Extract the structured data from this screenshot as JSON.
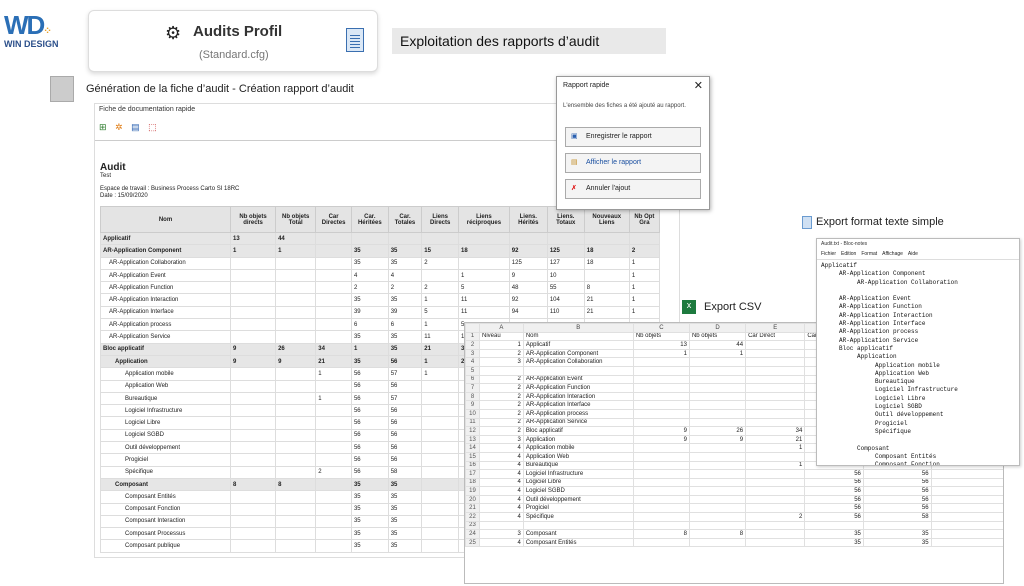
{
  "logo": {
    "brand": "WIN DESIGN"
  },
  "profil": {
    "title": "Audits Profil",
    "subtitle": "(Standard.cfg)"
  },
  "banner": "Exploitation des rapports d’audit",
  "generation": "Génération de la fiche d’audit - Création rapport d’audit",
  "main": {
    "window_title": "Fiche de documentation rapide",
    "audit": "Audit",
    "test": "Test",
    "espace": "Espace de travail : Business Process Carto SI 18RC",
    "date": "Date : 15/09/2020",
    "headers": [
      "Nom",
      "Nb objets directs",
      "Nb objets Total",
      "Car Directes",
      "Car. Héritées",
      "Car. Totales",
      "Liens Directs",
      "Liens réciproques",
      "Liens. Hérités",
      "Liens. Totaux",
      "Nouveaux Liens",
      "Nb Opt Gra"
    ],
    "rows": [
      [
        "Applicatif",
        "13",
        "44",
        "",
        "",
        "",
        "",
        "",
        "",
        "",
        "",
        ""
      ],
      [
        "AR-Application Component",
        "1",
        "1",
        "",
        "35",
        "35",
        "15",
        "18",
        "92",
        "125",
        "18",
        "2"
      ],
      [
        "AR-Application Collaboration",
        "",
        "",
        "",
        "35",
        "35",
        "2",
        "",
        "125",
        "127",
        "18",
        "1"
      ],
      [
        "AR-Application Event",
        "",
        "",
        "",
        "4",
        "4",
        "",
        "1",
        "9",
        "10",
        "",
        "1"
      ],
      [
        "AR-Application Function",
        "",
        "",
        "",
        "2",
        "2",
        "2",
        "5",
        "48",
        "55",
        "8",
        "1"
      ],
      [
        "AR-Application Interaction",
        "",
        "",
        "",
        "35",
        "35",
        "1",
        "11",
        "92",
        "104",
        "21",
        "1"
      ],
      [
        "AR-Application Interface",
        "",
        "",
        "",
        "39",
        "39",
        "5",
        "11",
        "94",
        "110",
        "21",
        "1"
      ],
      [
        "AR-Application process",
        "",
        "",
        "",
        "6",
        "6",
        "1",
        "5",
        "",
        "",
        "",
        ""
      ],
      [
        "AR-Application Service",
        "",
        "",
        "",
        "35",
        "35",
        "11",
        "1",
        "",
        "",
        "",
        ""
      ],
      [
        "Bloc applicatif",
        "9",
        "26",
        "34",
        "1",
        "35",
        "21",
        "3",
        "",
        "",
        "",
        ""
      ],
      [
        "Application",
        "9",
        "9",
        "21",
        "35",
        "56",
        "1",
        "2",
        "",
        "",
        "",
        ""
      ],
      [
        "Application mobile",
        "",
        "",
        "1",
        "56",
        "57",
        "1",
        "",
        "",
        "",
        "",
        ""
      ],
      [
        "Application Web",
        "",
        "",
        "",
        "56",
        "56",
        "",
        "",
        "",
        "",
        "",
        ""
      ],
      [
        "Bureautique",
        "",
        "",
        "1",
        "56",
        "57",
        "",
        "",
        "",
        "",
        "",
        ""
      ],
      [
        "Logiciel Infrastructure",
        "",
        "",
        "",
        "56",
        "56",
        "",
        "",
        "",
        "",
        "",
        ""
      ],
      [
        "Logiciel Libre",
        "",
        "",
        "",
        "56",
        "56",
        "",
        "",
        "",
        "",
        "",
        ""
      ],
      [
        "Logiciel SGBD",
        "",
        "",
        "",
        "56",
        "56",
        "",
        "",
        "",
        "",
        "",
        ""
      ],
      [
        "Outil développement",
        "",
        "",
        "",
        "56",
        "56",
        "",
        "",
        "",
        "",
        "",
        ""
      ],
      [
        "Progiciel",
        "",
        "",
        "",
        "56",
        "56",
        "",
        "",
        "",
        "",
        "",
        ""
      ],
      [
        "Spécifique",
        "",
        "",
        "2",
        "56",
        "58",
        "",
        "",
        "",
        "",
        "",
        ""
      ],
      [
        "Composant",
        "8",
        "8",
        "",
        "35",
        "35",
        "",
        "",
        "",
        "",
        "",
        ""
      ],
      [
        "Composant Entités",
        "",
        "",
        "",
        "35",
        "35",
        "",
        "",
        "",
        "",
        "",
        ""
      ],
      [
        "Composant Fonction",
        "",
        "",
        "",
        "35",
        "35",
        "",
        "",
        "",
        "",
        "",
        ""
      ],
      [
        "Composant Interaction",
        "",
        "",
        "",
        "35",
        "35",
        "",
        "",
        "",
        "",
        "",
        ""
      ],
      [
        "Composant Processus",
        "",
        "",
        "",
        "35",
        "35",
        "",
        "",
        "",
        "",
        "",
        ""
      ],
      [
        "Composant publique",
        "",
        "",
        "",
        "35",
        "35",
        "",
        "",
        "",
        "",
        "",
        ""
      ]
    ]
  },
  "dialog": {
    "title": "Rapport rapide",
    "message": "L'ensemble des fiches a été ajouté au rapport.",
    "b1": "Enregistrer le rapport",
    "b2": "Afficher le rapport",
    "b3": "Annuler l'ajout"
  },
  "csv": {
    "label": "Export CSV",
    "cols": [
      "A",
      "B",
      "C",
      "D",
      "E",
      "F",
      "G",
      "H"
    ],
    "rows": [
      [
        "1",
        "Niveau",
        "Nom",
        "Nb objets",
        "Nb objets",
        "Car Direct",
        "Car. Hériti",
        "Car. Totales",
        "Liens Directs"
      ],
      [
        "2",
        "1",
        "Applicatif",
        "13",
        "44",
        "",
        "",
        "",
        ""
      ],
      [
        "3",
        "2",
        "AR-Application Component",
        "1",
        "1",
        "",
        "35",
        "35",
        "15"
      ],
      [
        "4",
        "3",
        "AR-Application Collaboration",
        "",
        "",
        "",
        "35",
        "35",
        "2"
      ],
      [
        "5",
        "",
        "",
        "",
        "",
        "",
        "",
        "",
        ""
      ],
      [
        "6",
        "2",
        "AR-Application Event",
        "",
        "",
        "",
        "4",
        "4",
        ""
      ],
      [
        "7",
        "2",
        "AR-Application Function",
        "",
        "",
        "",
        "2",
        "2",
        "2"
      ],
      [
        "8",
        "2",
        "AR-Application Interaction",
        "",
        "",
        "",
        "35",
        "35",
        "1"
      ],
      [
        "9",
        "2",
        "AR-Application Interface",
        "",
        "",
        "",
        "39",
        "39",
        "5"
      ],
      [
        "10",
        "2",
        "AR-Application process",
        "",
        "",
        "",
        "6",
        "6",
        "1"
      ],
      [
        "11",
        "2",
        "AR-Application Service",
        "",
        "",
        "",
        "35",
        "35",
        "11"
      ],
      [
        "12",
        "2",
        "Bloc applicatif",
        "9",
        "26",
        "34",
        "1",
        "35",
        "21"
      ],
      [
        "13",
        "3",
        "Application",
        "9",
        "9",
        "21",
        "35",
        "56",
        "1"
      ],
      [
        "14",
        "4",
        "Application mobile",
        "",
        "",
        "1",
        "56",
        "57",
        "1"
      ],
      [
        "15",
        "4",
        "Application Web",
        "",
        "",
        "",
        "56",
        "56",
        ""
      ],
      [
        "16",
        "4",
        "Bureautique",
        "",
        "",
        "1",
        "56",
        "57",
        ""
      ],
      [
        "17",
        "4",
        "Logiciel Infrastructure",
        "",
        "",
        "",
        "56",
        "56",
        ""
      ],
      [
        "18",
        "4",
        "Logiciel Libre",
        "",
        "",
        "",
        "56",
        "56",
        ""
      ],
      [
        "19",
        "4",
        "Logiciel SGBD",
        "",
        "",
        "",
        "56",
        "56",
        ""
      ],
      [
        "20",
        "4",
        "Outil développement",
        "",
        "",
        "",
        "56",
        "56",
        ""
      ],
      [
        "21",
        "4",
        "Progiciel",
        "",
        "",
        "",
        "56",
        "56",
        ""
      ],
      [
        "22",
        "4",
        "Spécifique",
        "",
        "",
        "2",
        "56",
        "58",
        ""
      ],
      [
        "23",
        "",
        "",
        "",
        "",
        "",
        "",
        "",
        ""
      ],
      [
        "24",
        "3",
        "Composant",
        "8",
        "8",
        "",
        "35",
        "35",
        ""
      ],
      [
        "25",
        "4",
        "Composant Entités",
        "",
        "",
        "",
        "35",
        "35",
        ""
      ]
    ]
  },
  "txt": {
    "label": "Export format texte simple",
    "title": "Audit.txt - Bloc-notes",
    "menu": [
      "Fichier",
      "Edition",
      "Format",
      "Affichage",
      "Aide"
    ],
    "content": "Applicatif\n     AR-Application Component\n          AR-Application Collaboration\n\n     AR-Application Event\n     AR-Application Function\n     AR-Application Interaction\n     AR-Application Interface\n     AR-Application process\n     AR-Application Service\n     Bloc applicatif\n          Application\n               Application mobile\n               Application Web\n               Bureautique\n               Logiciel Infrastructure\n               Logiciel Libre\n               Logiciel SGBD\n               Outil développement\n               Progiciel\n               Spécifique\n\n          Composant\n               Composant Entités\n               Composant Fonction"
  }
}
